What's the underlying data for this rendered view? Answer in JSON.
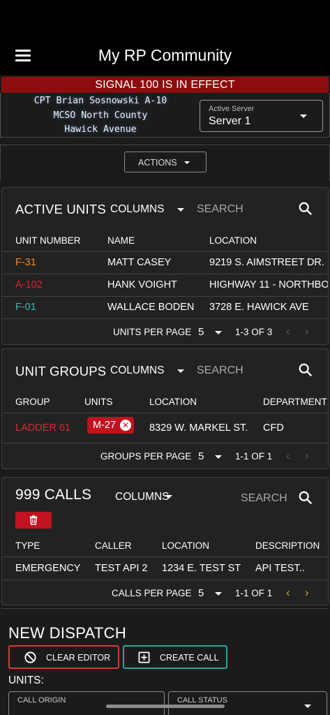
{
  "app": {
    "title": "My RP Community"
  },
  "signal_banner": "SIGNAL 100 IS IN EFFECT",
  "officer": {
    "line1": "CPT Brian Sosnowski A-10",
    "line2": "MCSO North County",
    "line3": "Hawick Avenue"
  },
  "server": {
    "label": "Active Server",
    "value": "Server 1"
  },
  "actions": {
    "label": "ACTIONS"
  },
  "active_units": {
    "title": "ACTIVE UNITS",
    "columns_label": "COLUMNS",
    "search_label": "SEARCH",
    "headers": [
      "UNIT NUMBER",
      "NAME",
      "LOCATION"
    ],
    "rows": [
      {
        "unit": "F-31",
        "unit_color": "#f28a2e",
        "name": "MATT CASEY",
        "location": "9219 S. AIMSTREET DR."
      },
      {
        "unit": "A-102",
        "unit_color": "#d42a34",
        "name": "HANK VOIGHT",
        "location": "HIGHWAY 11 - NORTHBO"
      },
      {
        "unit": "F-01",
        "unit_color": "#3fb6b0",
        "name": "WALLACE BODEN",
        "location": "3728 E. HAWICK AVE"
      }
    ],
    "per_page_label": "UNITS PER PAGE",
    "per_page_value": "5",
    "range": "1-3 OF 3"
  },
  "unit_groups": {
    "title": "UNIT GROUPS",
    "columns_label": "COLUMNS",
    "search_label": "SEARCH",
    "headers": [
      "GROUP",
      "UNITS",
      "LOCATION",
      "DEPARTMENT"
    ],
    "rows": [
      {
        "group": "LADDER 61",
        "group_color": "#d42a34",
        "unit_badge": "M-27",
        "location": "8329 W. MARKEL ST.",
        "department": "CFD"
      }
    ],
    "per_page_label": "GROUPS PER PAGE",
    "per_page_value": "5",
    "range": "1-1 OF 1"
  },
  "calls_999": {
    "title": "999 CALLS",
    "columns_label": "COLUMNS",
    "search_label": "SEARCH",
    "headers": [
      "TYPE",
      "CALLER",
      "LOCATION",
      "DESCRIPTION"
    ],
    "rows": [
      {
        "type": "EMERGENCY",
        "caller": "TEST API 2",
        "location": "1234 E. TEST ST",
        "description": "API TEST.."
      }
    ],
    "per_page_label": "CALLS PER PAGE",
    "per_page_value": "5",
    "range": "1-1 OF 1"
  },
  "new_dispatch": {
    "title": "NEW DISPATCH",
    "clear_label": "CLEAR EDITOR",
    "create_label": "CREATE CALL",
    "units_label": "UNITS:",
    "call_origin_label": "CALL ORIGIN",
    "call_status_label": "CALL STATUS"
  },
  "colors": {
    "signal_red": "#8b0d0d",
    "danger_red": "#c1121f",
    "teal": "#2aa69a",
    "pager_active": "#e0a020"
  }
}
